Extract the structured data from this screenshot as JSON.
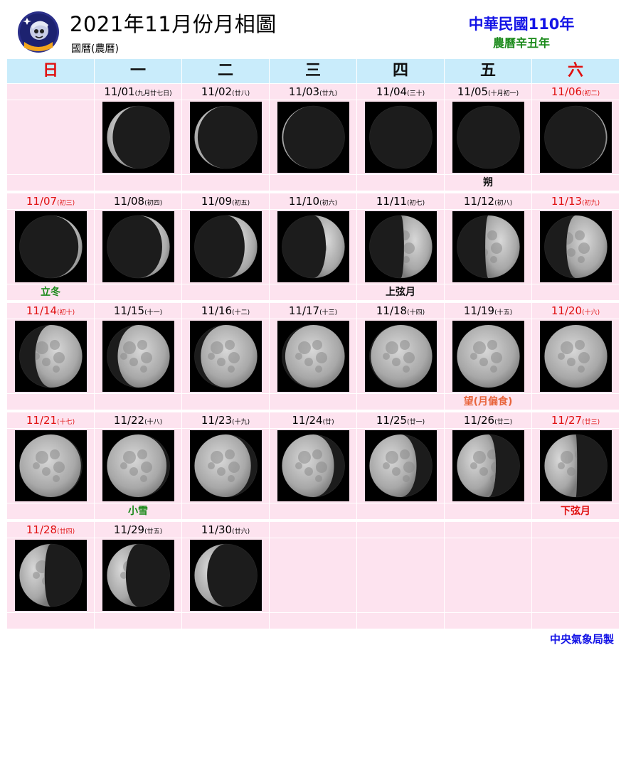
{
  "header": {
    "title": "2021年11月份月相圖",
    "subtitle": "國曆(農曆)",
    "roc_year": "中華民國110年",
    "lunar_year": "農曆辛丑年"
  },
  "weekdays": [
    {
      "label": "日",
      "red": true
    },
    {
      "label": "一",
      "red": false
    },
    {
      "label": "二",
      "red": false
    },
    {
      "label": "三",
      "red": false
    },
    {
      "label": "四",
      "red": false
    },
    {
      "label": "五",
      "red": false
    },
    {
      "label": "六",
      "red": true
    }
  ],
  "weeks": [
    [
      null,
      {
        "date": "11/01",
        "lunar": "(九月廿七日)",
        "illum": 0.09,
        "wax": false,
        "event": ""
      },
      {
        "date": "11/02",
        "lunar": "(廿八)",
        "illum": 0.05,
        "wax": false,
        "event": ""
      },
      {
        "date": "11/03",
        "lunar": "(廿九)",
        "illum": 0.02,
        "wax": false,
        "event": ""
      },
      {
        "date": "11/04",
        "lunar": "(三十)",
        "illum": 0.0,
        "wax": false,
        "event": ""
      },
      {
        "date": "11/05",
        "lunar": "(十月初一)",
        "illum": 0.0,
        "wax": true,
        "event": "朔",
        "event_color": "black"
      },
      {
        "date": "11/06",
        "lunar": "(初二)",
        "illum": 0.02,
        "wax": true,
        "event": "",
        "red": true
      }
    ],
    [
      {
        "date": "11/07",
        "lunar": "(初三)",
        "illum": 0.06,
        "wax": true,
        "event": "立冬",
        "event_color": "green",
        "red": true
      },
      {
        "date": "11/08",
        "lunar": "(初四)",
        "illum": 0.12,
        "wax": true,
        "event": ""
      },
      {
        "date": "11/09",
        "lunar": "(初五)",
        "illum": 0.2,
        "wax": true,
        "event": ""
      },
      {
        "date": "11/10",
        "lunar": "(初六)",
        "illum": 0.3,
        "wax": true,
        "event": ""
      },
      {
        "date": "11/11",
        "lunar": "(初七)",
        "illum": 0.45,
        "wax": true,
        "event": "上弦月",
        "event_color": "black"
      },
      {
        "date": "11/12",
        "lunar": "(初八)",
        "illum": 0.55,
        "wax": true,
        "event": ""
      },
      {
        "date": "11/13",
        "lunar": "(初九)",
        "illum": 0.65,
        "wax": true,
        "event": "",
        "red": true
      }
    ],
    [
      {
        "date": "11/14",
        "lunar": "(初十)",
        "illum": 0.75,
        "wax": true,
        "event": "",
        "red": true
      },
      {
        "date": "11/15",
        "lunar": "(十一)",
        "illum": 0.83,
        "wax": true,
        "event": ""
      },
      {
        "date": "11/16",
        "lunar": "(十二)",
        "illum": 0.9,
        "wax": true,
        "event": ""
      },
      {
        "date": "11/17",
        "lunar": "(十三)",
        "illum": 0.95,
        "wax": true,
        "event": ""
      },
      {
        "date": "11/18",
        "lunar": "(十四)",
        "illum": 0.98,
        "wax": true,
        "event": ""
      },
      {
        "date": "11/19",
        "lunar": "(十五)",
        "illum": 1.0,
        "wax": true,
        "event": "望(月偏食)",
        "event_color": "orange"
      },
      {
        "date": "11/20",
        "lunar": "(十六)",
        "illum": 1.0,
        "wax": false,
        "event": "",
        "red": true
      }
    ],
    [
      {
        "date": "11/21",
        "lunar": "(十七)",
        "illum": 0.98,
        "wax": false,
        "event": "",
        "red": true
      },
      {
        "date": "11/22",
        "lunar": "(十八)",
        "illum": 0.95,
        "wax": false,
        "event": "小雪",
        "event_color": "green"
      },
      {
        "date": "11/23",
        "lunar": "(十九)",
        "illum": 0.9,
        "wax": false,
        "event": ""
      },
      {
        "date": "11/24",
        "lunar": "(廿)",
        "illum": 0.83,
        "wax": false,
        "event": ""
      },
      {
        "date": "11/25",
        "lunar": "(廿一)",
        "illum": 0.75,
        "wax": false,
        "event": ""
      },
      {
        "date": "11/26",
        "lunar": "(廿二)",
        "illum": 0.62,
        "wax": false,
        "event": ""
      },
      {
        "date": "11/27",
        "lunar": "(廿三)",
        "illum": 0.52,
        "wax": false,
        "event": "下弦月",
        "event_color": "red",
        "red": true
      }
    ],
    [
      {
        "date": "11/28",
        "lunar": "(廿四)",
        "illum": 0.4,
        "wax": false,
        "event": "",
        "red": true
      },
      {
        "date": "11/29",
        "lunar": "(廿五)",
        "illum": 0.3,
        "wax": false,
        "event": ""
      },
      {
        "date": "11/30",
        "lunar": "(廿六)",
        "illum": 0.2,
        "wax": false,
        "event": ""
      },
      null,
      null,
      null,
      null
    ]
  ],
  "footer": "中央氣象局製"
}
